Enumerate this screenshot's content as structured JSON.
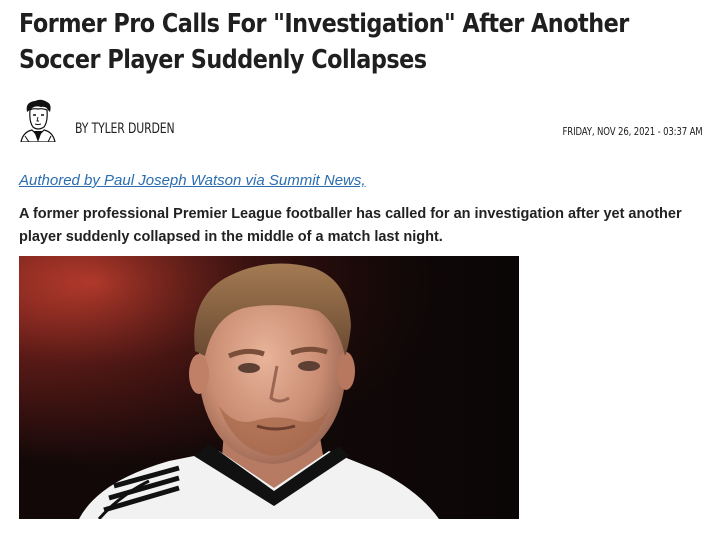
{
  "article": {
    "headline": "Former Pro Calls For \"Investigation\" After Another Soccer Player Suddenly Collapses",
    "byline": "BY TYLER DURDEN",
    "date": "FRIDAY, NOV 26, 2021 - 03:37 AM",
    "source_link": "Authored by Paul Joseph Watson via Summit News,",
    "lead": "A former professional Premier League footballer has called for an investigation after yet another player suddenly collapsed in the middle of a match last night."
  },
  "colors": {
    "link": "#2a6db0",
    "text": "#222222"
  },
  "icons": {
    "avatar": "author-avatar-sketch"
  }
}
